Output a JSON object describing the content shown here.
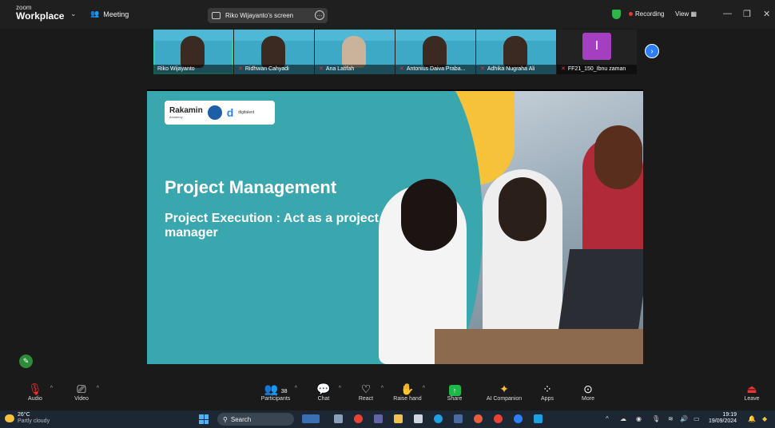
{
  "titlebar": {
    "app_small": "zoom",
    "app_name": "Workplace",
    "meeting_label": "Meeting",
    "screen_label": "Riko Wijayanto's screen",
    "recording_label": "Recording",
    "view_label": "View"
  },
  "participants_strip": [
    {
      "name": "Riko Wijayanto",
      "muted": false
    },
    {
      "name": "Ridhwan Cahyadi",
      "muted": true
    },
    {
      "name": "Ana Latifah",
      "muted": true
    },
    {
      "name": "Antonius Daiva Praba...",
      "muted": true
    },
    {
      "name": "Adhika Nugraha Ali",
      "muted": true
    },
    {
      "name": "FF21_150_Ibnu zaman",
      "muted": true,
      "avatar_letter": "I"
    }
  ],
  "slide": {
    "logo_text": "Rakamin",
    "logo_sub": "Academy",
    "logo_brand2": "digitalent",
    "title": "Project Management",
    "subtitle": "Project Execution : Act as a project manager"
  },
  "toolbar": {
    "audio": "Audio",
    "video": "Video",
    "participants": "Participants",
    "participants_count": "38",
    "chat": "Chat",
    "react": "React",
    "raise_hand": "Raise hand",
    "share": "Share",
    "ai_companion": "AI Companion",
    "apps": "Apps",
    "more": "More",
    "leave": "Leave"
  },
  "taskbar": {
    "temperature": "26°C",
    "weather": "Partly cloudy",
    "search_placeholder": "Search",
    "time": "19:19",
    "date": "19/09/2024"
  },
  "colors": {
    "active_speaker": "#2fd1a4",
    "slide_teal": "#3aa6ad",
    "accent_yellow": "#f5c23a",
    "share_green": "#1eb84a",
    "leave_red": "#e33333"
  }
}
